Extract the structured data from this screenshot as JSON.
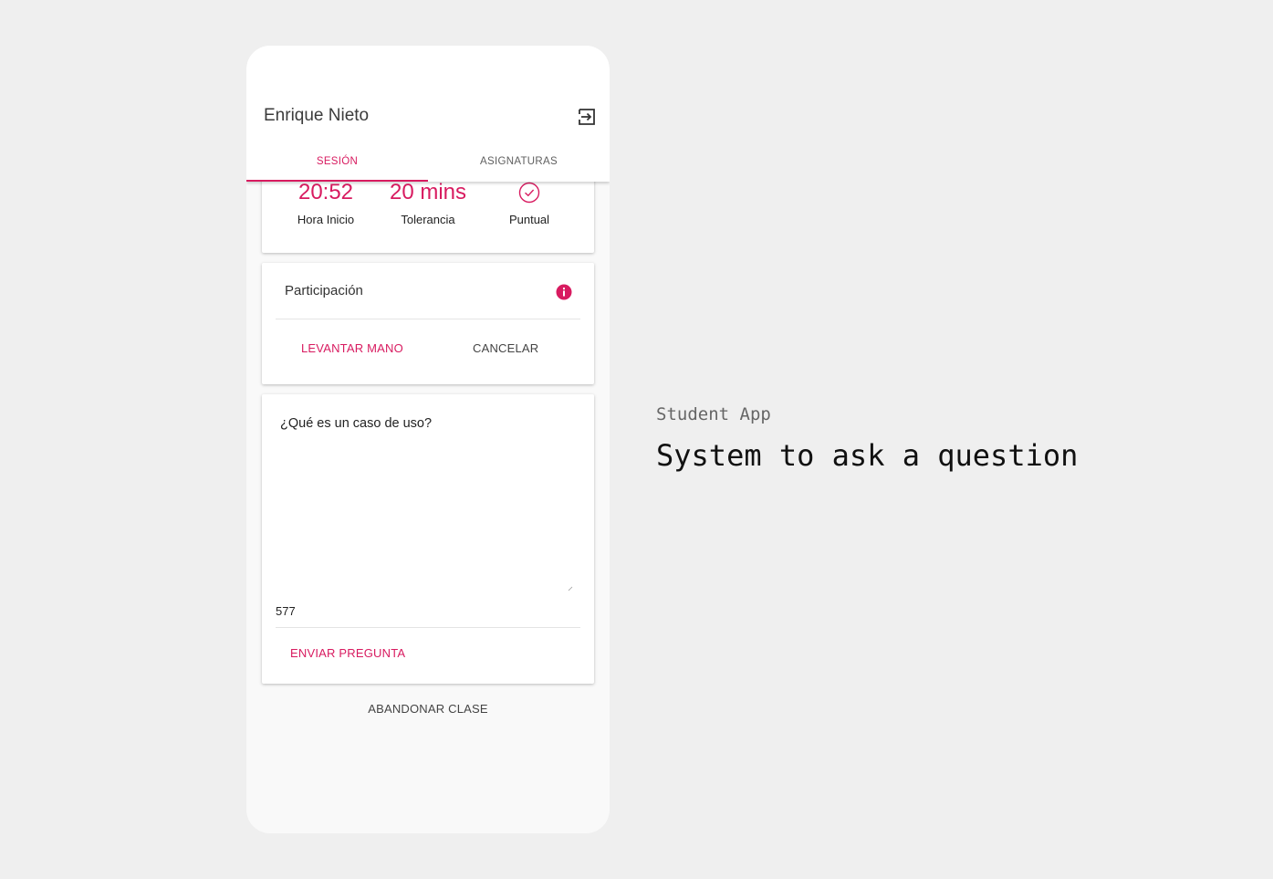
{
  "app": {
    "user_name": "Enrique Nieto",
    "logout_icon": "logout-icon",
    "accent_color": "#d81b60"
  },
  "tabs": [
    {
      "label": "SESIÓN",
      "active": true
    },
    {
      "label": "ASIGNATURAS",
      "active": false
    }
  ],
  "session": {
    "start_time": "20:52",
    "start_label": "Hora Inicio",
    "tolerance": "20 mins",
    "tolerance_label": "Tolerancia",
    "status_icon": "check-circle-icon",
    "status_label": "Puntual"
  },
  "participation": {
    "title": "Participación",
    "info_icon": "info-icon",
    "raise_hand_label": "LEVANTAR MANO",
    "cancel_label": "CANCELAR"
  },
  "question": {
    "value": "¿Qué es un caso de uso?",
    "remaining_chars": "577",
    "send_label": "ENVIAR PREGUNTA"
  },
  "leave_class_label": "ABANDONAR CLASE",
  "caption": {
    "subtitle": "Student App",
    "title": "System to ask a question"
  }
}
